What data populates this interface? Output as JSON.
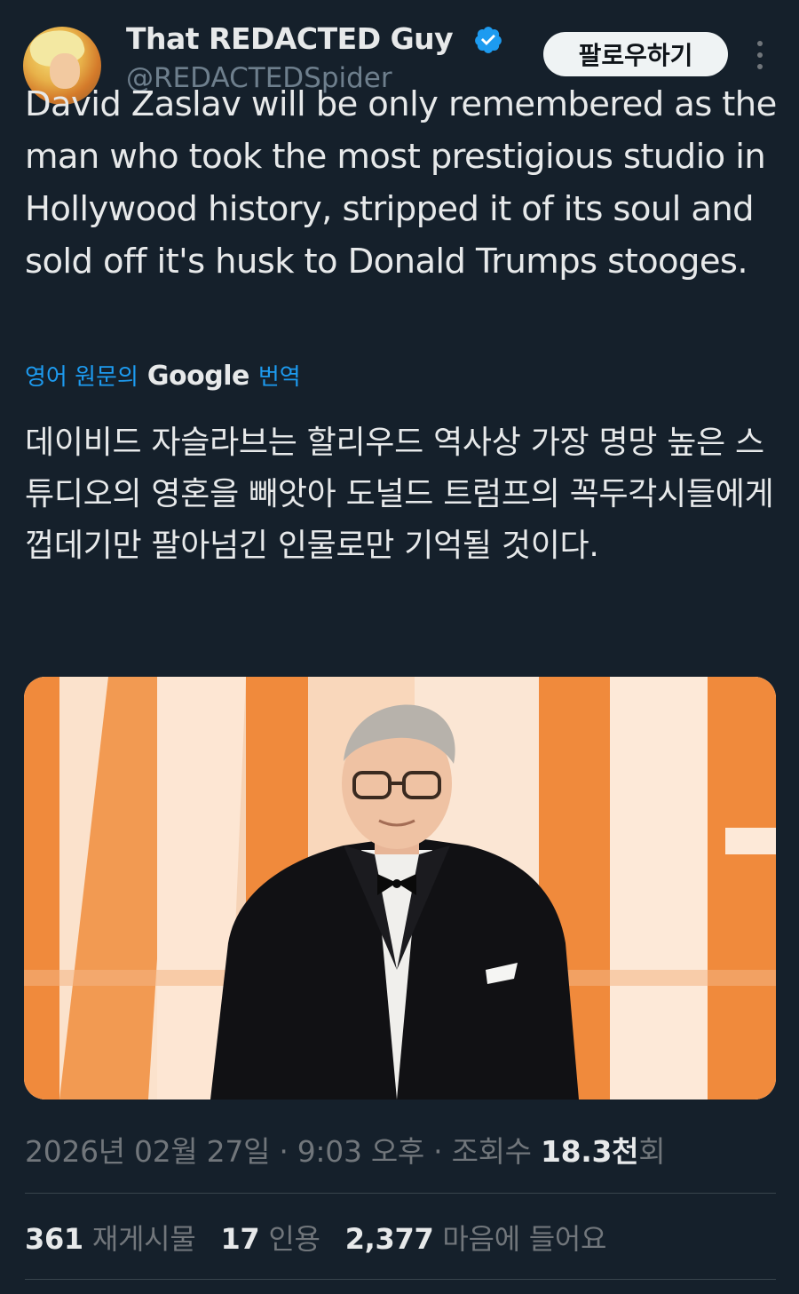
{
  "author": {
    "display_name": "That REDACTED Guy",
    "handle": "@REDACTEDSpider",
    "verified": true,
    "avatar_icon": "anime-avatar"
  },
  "header": {
    "follow_label": "팔로우하기",
    "more_icon": "more-vertical-icon"
  },
  "tweet": {
    "text": "David Zaslav will be only remembered as the man who took the most prestigious studio in Hollywood history, stripped it of its soul and sold off it's husk to Donald Trumps stooges.",
    "translate_prefix": "영어 원문의",
    "translate_brand": "Google",
    "translate_suffix": "번역",
    "translated_text": "데이비드 자슬라브는 할리우드 역사상 가장 명망 높은 스튜디오의 영혼을 빼앗아 도널드 트럼프의 꼭두각시들에게 껍데기만 팔아넘긴 인물로만 기억될 것이다."
  },
  "meta": {
    "date": "2026년 02월 27일",
    "separator": "·",
    "time": "9:03 오후",
    "views_label": "조회수",
    "views_value": "18.3천",
    "views_suffix": "회"
  },
  "stats": {
    "reposts_count": "361",
    "reposts_label": "재게시물",
    "quotes_count": "17",
    "quotes_label": "인용",
    "likes_count": "2,377",
    "likes_label": "마음에 들어요"
  },
  "colors": {
    "background": "#15202b",
    "text": "#e7e9ea",
    "muted": "#71767b",
    "link": "#1d9bf0",
    "verified": "#1d9bf0"
  }
}
